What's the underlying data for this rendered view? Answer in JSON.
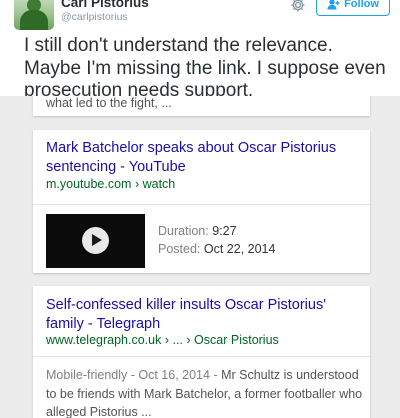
{
  "tweet": {
    "display_name": "Carl Pistorius",
    "username": "@carlpistorius",
    "follow_label": "Follow",
    "text": "I still don't understand the relevance. Maybe I'm missing the link. I suppose even prosecution needs support."
  },
  "search_results": {
    "top_snippet": "what led to the fight, ...",
    "youtube": {
      "title": "Mark Batchelor speaks about Oscar Pistorius sentencing - YouTube",
      "url_domain": "m.youtube.com",
      "url_sep": "›",
      "url_path": "watch",
      "duration_label": "Duration:",
      "duration_value": "9:27",
      "posted_label": "Posted:",
      "posted_value": "Oct 22, 2014"
    },
    "telegraph": {
      "title": "Self-confessed killer insults Oscar Pistorius' family - Telegraph",
      "url_domain": "www.telegraph.co.uk",
      "url_sep1": "›",
      "url_ellipsis": "...",
      "url_sep2": "›",
      "url_path": "Oscar Pistorius",
      "snippet_lead": "Mobile-friendly - Oct 16, 2014 -",
      "snippet_text": "Mr Schultz is understood to be friends with Mark Batchelor, a former footballer who alleged Pistorius ..."
    }
  },
  "colors": {
    "twitter_blue": "#1da1f2",
    "link_blue": "#1a0dab",
    "url_green": "#006621",
    "card_background": "#ececec"
  },
  "icons": {
    "gear": "gear-icon",
    "follow": "add-person-icon",
    "play": "play-icon"
  }
}
